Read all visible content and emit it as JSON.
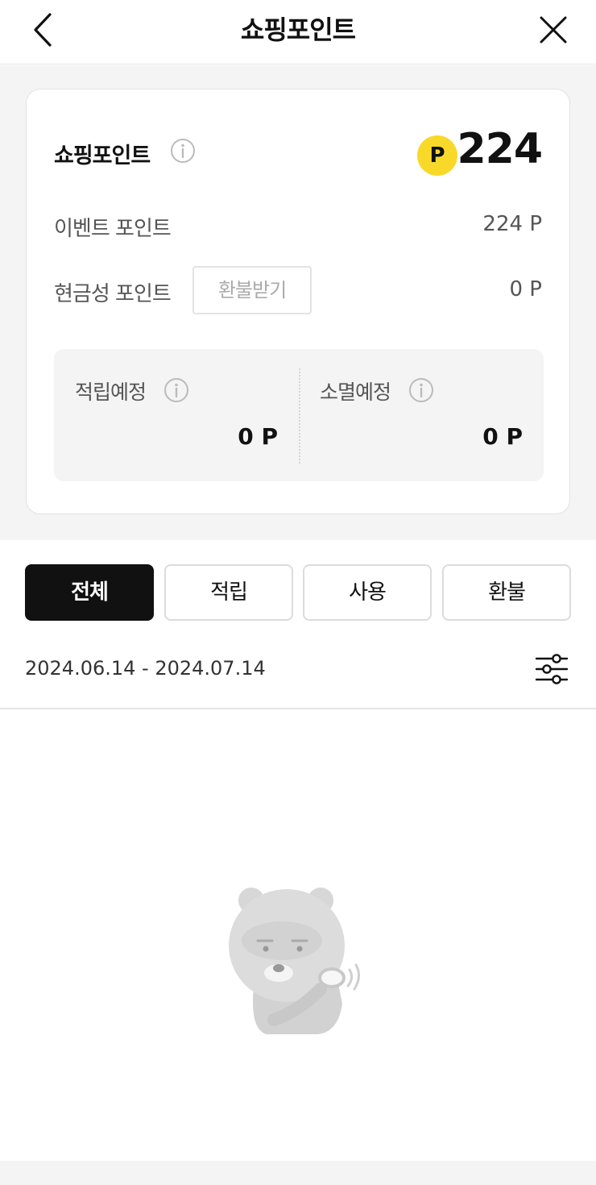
{
  "header": {
    "title": "쇼핑포인트",
    "back_icon": "chevron-left-icon",
    "close_icon": "close-icon"
  },
  "summary": {
    "title": "쇼핑포인트",
    "coin_label": "P",
    "total": "224",
    "accent_color": "#f8d92a"
  },
  "rows": {
    "event_label": "이벤트 포인트",
    "event_value": "224 P",
    "cash_label": "현금성 포인트",
    "refund_button": "환불받기",
    "cash_value": "0 P"
  },
  "pending": {
    "earn_label": "적립예정",
    "earn_value": "0 P",
    "expire_label": "소멸예정",
    "expire_value": "0 P"
  },
  "tabs": [
    {
      "label": "전체",
      "active": true
    },
    {
      "label": "적립",
      "active": false
    },
    {
      "label": "사용",
      "active": false
    },
    {
      "label": "환불",
      "active": false
    }
  ],
  "filter": {
    "date_range": "2024.06.14 - 2024.07.14",
    "icon": "sliders-icon"
  },
  "empty_state": {
    "icon": "bear-character-icon"
  }
}
